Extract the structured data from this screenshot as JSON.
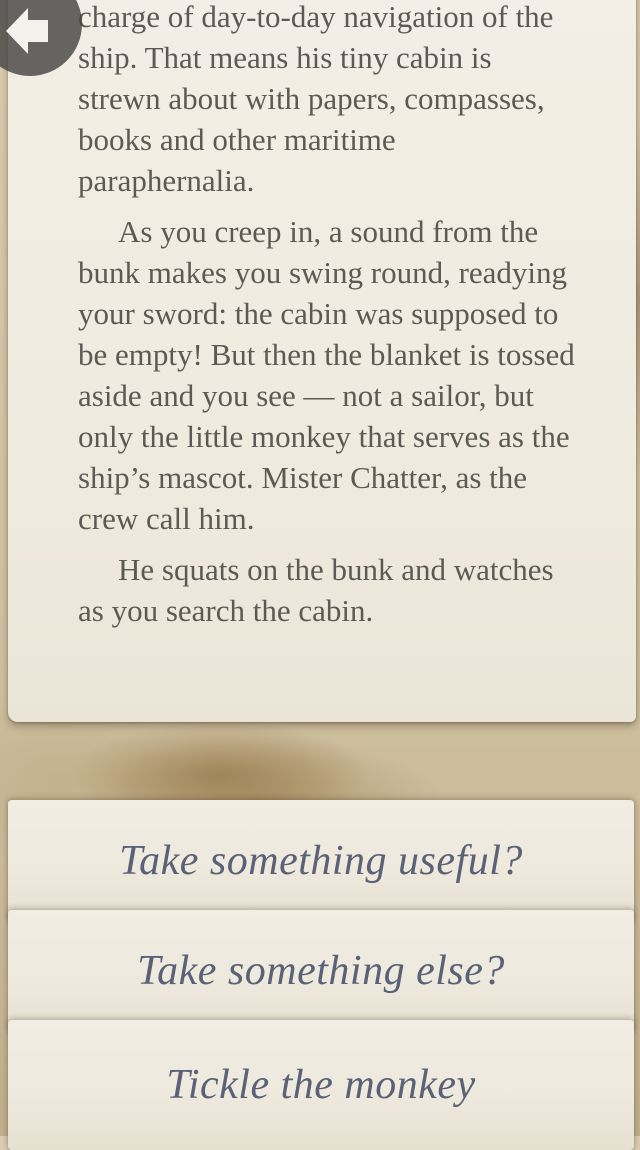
{
  "story": {
    "paragraphs": [
      "charge of day-to-day navigation of the ship. That means his tiny cabin is strewn about with papers, compasses, books and other maritime paraphernalia.",
      "As you creep in, a sound from the bunk makes you swing round, readying your sword: the cabin was supposed to be empty! But then the blanket is tossed aside and you see — not a sailor, but only the little monkey that serves as the ship’s mascot. Mister Chatter, as the crew call him.",
      "He squats on the bunk and watches as you search the cabin."
    ]
  },
  "choices": [
    {
      "label": "Take something useful?"
    },
    {
      "label": "Take something else?"
    },
    {
      "label": "Tickle the monkey"
    }
  ],
  "icons": {
    "back": "back-arrow-icon"
  },
  "colors": {
    "story_text": "#5c5a55",
    "choice_text": "#5a6278",
    "paper": "#f1ede3"
  }
}
